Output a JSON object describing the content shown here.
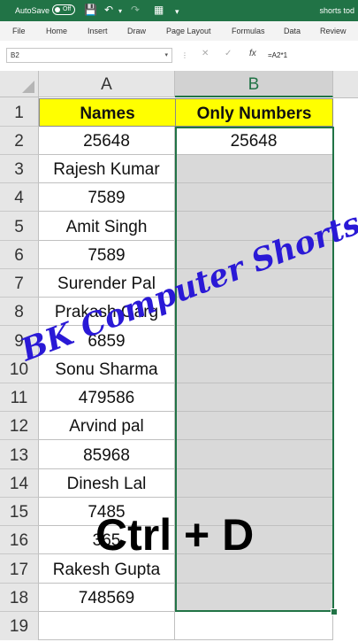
{
  "titlebar": {
    "autosave": "AutoSave",
    "toggle": "Off",
    "doc_title": "shorts tod"
  },
  "ribbon": {
    "tabs": [
      "File",
      "Home",
      "Insert",
      "Draw",
      "Page Layout",
      "Formulas",
      "Data",
      "Review"
    ]
  },
  "formula_bar": {
    "name_box": "B2",
    "formula": "=A2*1"
  },
  "grid": {
    "columns": [
      "A",
      "B"
    ],
    "selected_column": "B",
    "header": {
      "col_a": "Names",
      "col_b": "Only Numbers",
      "highlight": "#ffff00"
    },
    "rows": [
      {
        "num": "1"
      },
      {
        "num": "2",
        "a": "25648",
        "b": "25648"
      },
      {
        "num": "3",
        "a": "Rajesh Kumar",
        "b": ""
      },
      {
        "num": "4",
        "a": "7589",
        "b": ""
      },
      {
        "num": "5",
        "a": "Amit Singh",
        "b": ""
      },
      {
        "num": "6",
        "a": "7589",
        "b": ""
      },
      {
        "num": "7",
        "a": "Surender Pal",
        "b": ""
      },
      {
        "num": "8",
        "a": "Prakash Garg",
        "b": ""
      },
      {
        "num": "9",
        "a": "6859",
        "b": ""
      },
      {
        "num": "10",
        "a": "Sonu Sharma",
        "b": ""
      },
      {
        "num": "11",
        "a": "479586",
        "b": ""
      },
      {
        "num": "12",
        "a": "Arvind pal",
        "b": ""
      },
      {
        "num": "13",
        "a": "85968",
        "b": ""
      },
      {
        "num": "14",
        "a": "Dinesh Lal",
        "b": ""
      },
      {
        "num": "15",
        "a": "7485",
        "b": ""
      },
      {
        "num": "16",
        "a": "365",
        "b": ""
      },
      {
        "num": "17",
        "a": "Rakesh Gupta",
        "b": ""
      },
      {
        "num": "18",
        "a": "748569",
        "b": ""
      },
      {
        "num": "19"
      }
    ]
  },
  "overlay": {
    "watermark": "BK Computer Shorts",
    "shortcut": "Ctrl + D",
    "watermark_color": "#2a19d6"
  },
  "colors": {
    "excel_green": "#217346",
    "selection_fill": "#d9d9d9"
  }
}
